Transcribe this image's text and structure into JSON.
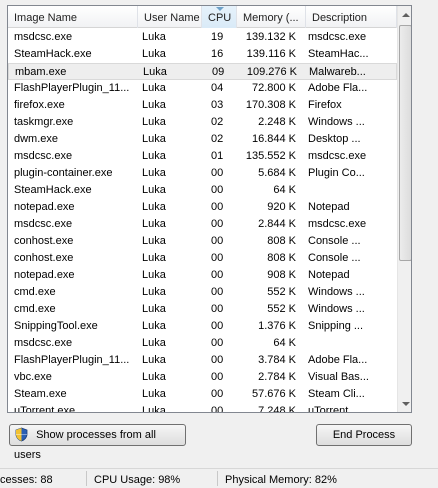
{
  "columns": {
    "image_name": "Image Name",
    "user_name": "User Name",
    "cpu": "CPU",
    "memory": "Memory (...",
    "description": "Description"
  },
  "rows": [
    {
      "name": "msdcsc.exe",
      "user": "Luka",
      "cpu": "19",
      "mem": "139.132 K",
      "desc": "msdcsc.exe"
    },
    {
      "name": "SteamHack.exe",
      "user": "Luka",
      "cpu": "16",
      "mem": "139.116 K",
      "desc": "SteamHac..."
    },
    {
      "name": "mbam.exe",
      "user": "Luka",
      "cpu": "09",
      "mem": "109.276 K",
      "desc": "Malwareb..."
    },
    {
      "name": "FlashPlayerPlugin_11...",
      "user": "Luka",
      "cpu": "04",
      "mem": "72.800 K",
      "desc": "Adobe Fla..."
    },
    {
      "name": "firefox.exe",
      "user": "Luka",
      "cpu": "03",
      "mem": "170.308 K",
      "desc": "Firefox"
    },
    {
      "name": "taskmgr.exe",
      "user": "Luka",
      "cpu": "02",
      "mem": "2.248 K",
      "desc": "Windows ..."
    },
    {
      "name": "dwm.exe",
      "user": "Luka",
      "cpu": "02",
      "mem": "16.844 K",
      "desc": "Desktop ..."
    },
    {
      "name": "msdcsc.exe",
      "user": "Luka",
      "cpu": "01",
      "mem": "135.552 K",
      "desc": "msdcsc.exe"
    },
    {
      "name": "plugin-container.exe",
      "user": "Luka",
      "cpu": "00",
      "mem": "5.684 K",
      "desc": "Plugin Co..."
    },
    {
      "name": "SteamHack.exe",
      "user": "Luka",
      "cpu": "00",
      "mem": "64 K",
      "desc": ""
    },
    {
      "name": "notepad.exe",
      "user": "Luka",
      "cpu": "00",
      "mem": "920 K",
      "desc": "Notepad"
    },
    {
      "name": "msdcsc.exe",
      "user": "Luka",
      "cpu": "00",
      "mem": "2.844 K",
      "desc": "msdcsc.exe"
    },
    {
      "name": "conhost.exe",
      "user": "Luka",
      "cpu": "00",
      "mem": "808 K",
      "desc": "Console ..."
    },
    {
      "name": "conhost.exe",
      "user": "Luka",
      "cpu": "00",
      "mem": "808 K",
      "desc": "Console ..."
    },
    {
      "name": "notepad.exe",
      "user": "Luka",
      "cpu": "00",
      "mem": "908 K",
      "desc": "Notepad"
    },
    {
      "name": "cmd.exe",
      "user": "Luka",
      "cpu": "00",
      "mem": "552 K",
      "desc": "Windows ..."
    },
    {
      "name": "cmd.exe",
      "user": "Luka",
      "cpu": "00",
      "mem": "552 K",
      "desc": "Windows ..."
    },
    {
      "name": "SnippingTool.exe",
      "user": "Luka",
      "cpu": "00",
      "mem": "1.376 K",
      "desc": "Snipping ..."
    },
    {
      "name": "msdcsc.exe",
      "user": "Luka",
      "cpu": "00",
      "mem": "64 K",
      "desc": ""
    },
    {
      "name": "FlashPlayerPlugin_11...",
      "user": "Luka",
      "cpu": "00",
      "mem": "3.784 K",
      "desc": "Adobe Fla..."
    },
    {
      "name": "vbc.exe",
      "user": "Luka",
      "cpu": "00",
      "mem": "2.784 K",
      "desc": "Visual Bas..."
    },
    {
      "name": "Steam.exe",
      "user": "Luka",
      "cpu": "00",
      "mem": "57.676 K",
      "desc": "Steam Cli..."
    },
    {
      "name": "uTorrent.exe",
      "user": "Luka",
      "cpu": "00",
      "mem": "7.248 K",
      "desc": "uTorrent"
    }
  ],
  "selected_row": 2,
  "buttons": {
    "show_all": "Show processes from all users",
    "end_process": "End Process"
  },
  "status": {
    "processes": "cesses: 88",
    "cpu_usage": "CPU Usage: 98%",
    "physical_memory": "Physical Memory: 82%"
  },
  "icons": {
    "uac_shield": "shield-icon",
    "sort": "sort-down-icon"
  },
  "colors": {
    "window_bg": "#f0f0f0",
    "list_bg": "#ffffff",
    "selected_row_bg": "#eeeeee",
    "sorted_header_bg": "#d9eaf7"
  }
}
